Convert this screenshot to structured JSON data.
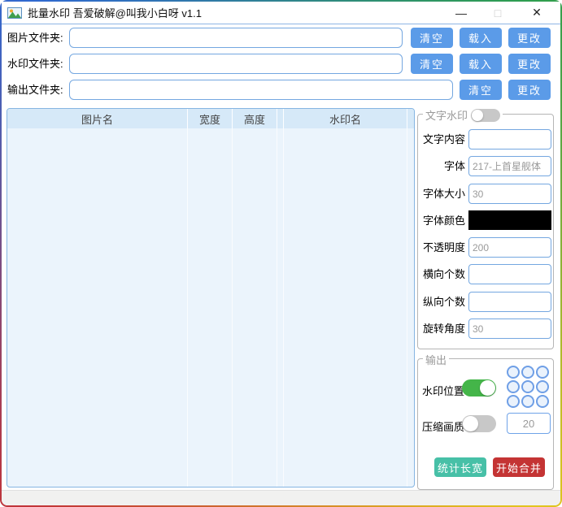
{
  "window": {
    "title": "批量水印 吾爱破解@叫我小白呀 v1.1",
    "minimize_glyph": "—",
    "maximize_glyph": "□",
    "close_glyph": "✕"
  },
  "folders": {
    "image": {
      "label": "图片文件夹:",
      "value": "",
      "clear": "清空",
      "load": "载入",
      "change": "更改"
    },
    "watermark": {
      "label": "水印文件夹:",
      "value": "",
      "clear": "清空",
      "load": "载入",
      "change": "更改"
    },
    "output": {
      "label": "输出文件夹:",
      "value": "",
      "clear": "清空",
      "change": "更改"
    }
  },
  "table": {
    "columns": [
      {
        "label": "图片名"
      },
      {
        "label": "宽度"
      },
      {
        "label": "高度"
      },
      {
        "label": ""
      },
      {
        "label": "水印名"
      }
    ],
    "rows": []
  },
  "text_watermark": {
    "title": "文字水印",
    "enabled": false,
    "fields": {
      "content": {
        "label": "文字内容",
        "value": ""
      },
      "font": {
        "label": "字体",
        "value": "217-上首星舰体"
      },
      "size": {
        "label": "字体大小",
        "value": "30"
      },
      "color": {
        "label": "字体颜色",
        "value": "#000000"
      },
      "opacity": {
        "label": "不透明度",
        "value": "200"
      },
      "h_count": {
        "label": "横向个数",
        "value": ""
      },
      "v_count": {
        "label": "纵向个数",
        "value": ""
      },
      "angle": {
        "label": "旋转角度",
        "value": "30"
      }
    }
  },
  "output_group": {
    "title": "输出",
    "position": {
      "label": "水印位置",
      "enabled": true
    },
    "quality": {
      "label": "压缩画质",
      "enabled": false,
      "value": "20"
    },
    "measure_button": {
      "label": "统计长宽",
      "bg": "#47c0a7"
    },
    "start_button": {
      "label": "开始合并",
      "bg": "#c43434"
    }
  },
  "colors": {
    "accent_blue": "#5b9be8",
    "input_border": "#74a7e0",
    "table_header_bg": "#d6e9f8",
    "table_body_bg": "#ebf4fc",
    "toggle_on": "#44b549",
    "toggle_off": "#c8c8c8",
    "font_color_swatch": "#000000"
  }
}
